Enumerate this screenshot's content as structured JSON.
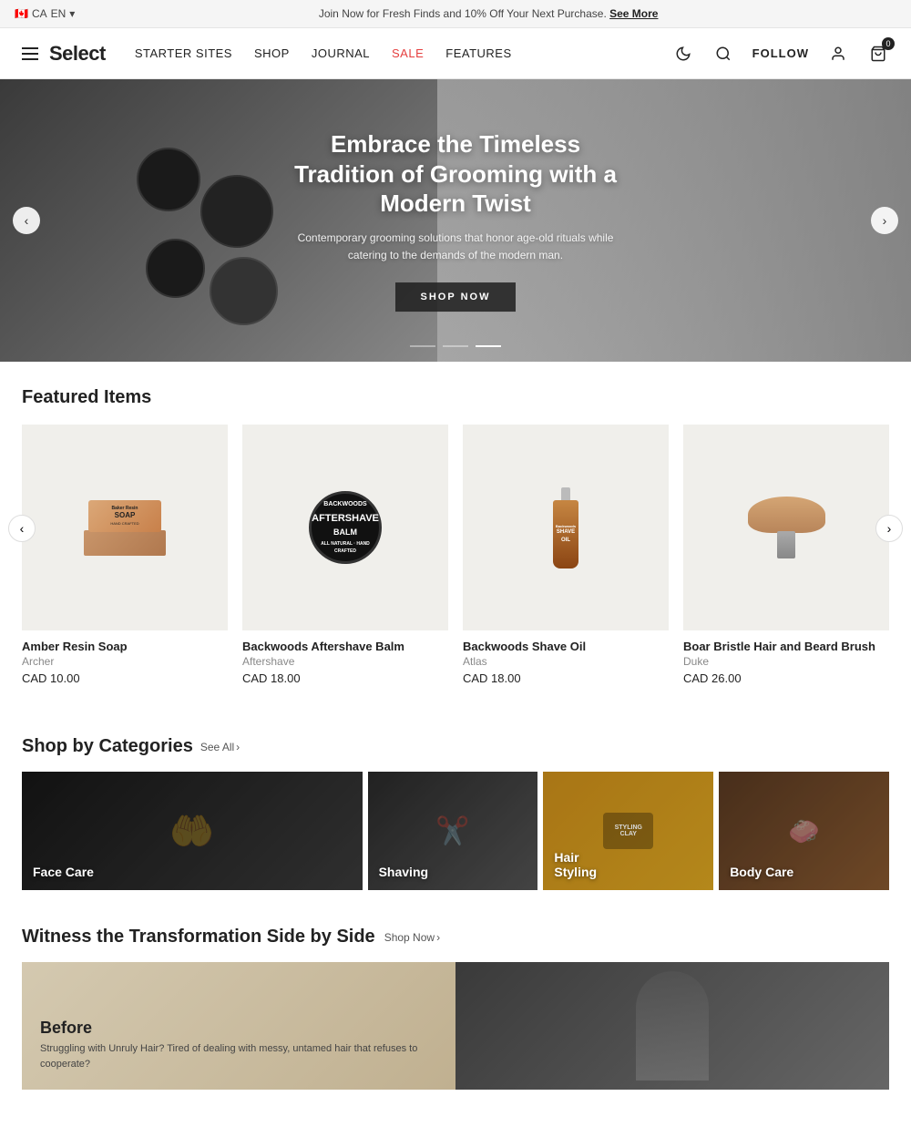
{
  "announcement": {
    "flag": "🇨🇦",
    "locale_ca": "CA",
    "locale_en": "EN",
    "text": "Join Now for Fresh Finds and 10% Off Your Next Purchase.",
    "see_more": "See More"
  },
  "header": {
    "logo": "Select",
    "nav": [
      {
        "id": "starter-sites",
        "label": "STARTER SITES",
        "sale": false
      },
      {
        "id": "shop",
        "label": "SHOP",
        "sale": false
      },
      {
        "id": "journal",
        "label": "JOURNAL",
        "sale": false
      },
      {
        "id": "sale",
        "label": "SALE",
        "sale": true
      },
      {
        "id": "features",
        "label": "FEATURES",
        "sale": false
      }
    ],
    "follow": "FOLLOW",
    "cart_count": "0"
  },
  "hero": {
    "title": "Embrace the Timeless Tradition of Grooming with a Modern Twist",
    "subtitle": "Contemporary grooming solutions that honor age-old rituals while catering to the demands of the modern man.",
    "cta": "SHOP NOW",
    "dots": [
      {
        "active": false
      },
      {
        "active": false
      },
      {
        "active": true
      }
    ]
  },
  "featured": {
    "title": "Featured Items",
    "products": [
      {
        "name": "Amber Resin Soap",
        "brand": "Archer",
        "price": "CAD 10.00",
        "img_type": "soap"
      },
      {
        "name": "Backwoods Aftershave Balm",
        "brand": "Aftershave",
        "price": "CAD 18.00",
        "img_type": "balm"
      },
      {
        "name": "Backwoods Shave Oil",
        "brand": "Atlas",
        "price": "CAD 18.00",
        "img_type": "oil"
      },
      {
        "name": "Boar Bristle Hair and Beard Brush",
        "brand": "Duke",
        "price": "CAD 26.00",
        "img_type": "brush"
      }
    ]
  },
  "categories": {
    "title": "Shop by Categories",
    "see_all": "See All",
    "items": [
      {
        "id": "face-care",
        "label": "Face Care",
        "style": "cat-face"
      },
      {
        "id": "shaving",
        "label": "Shaving",
        "style": "cat-shaving"
      },
      {
        "id": "hair-styling",
        "label": "Hair\nStyling",
        "style": "cat-hair"
      },
      {
        "id": "body-care",
        "label": "Body Care",
        "style": "cat-body"
      }
    ]
  },
  "transformation": {
    "title": "Witness the Transformation Side by Side",
    "shop_now": "Shop Now",
    "before_label": "Before",
    "before_text": "Struggling with Unruly Hair? Tired of dealing with messy, untamed hair that refuses to cooperate?"
  }
}
